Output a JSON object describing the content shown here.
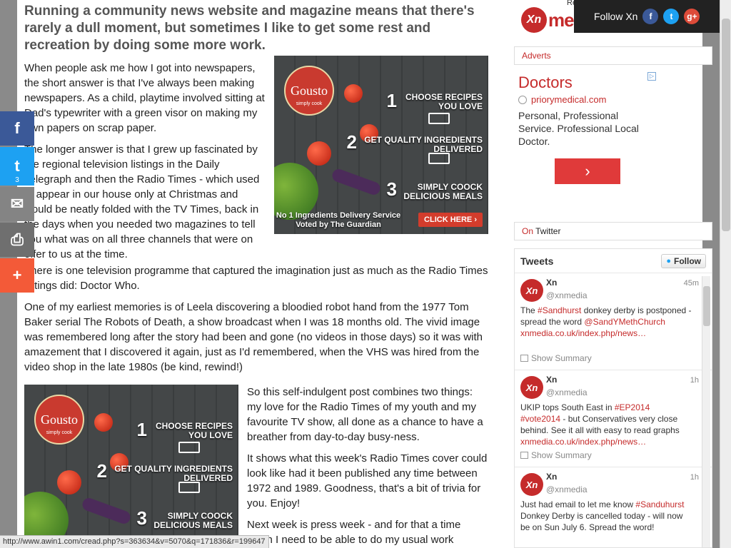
{
  "article": {
    "intro": "Running a community news website and magazine means that there's rarely a dull moment, but sometimes I like to get some rest and recreation by doing some more work.",
    "paragraphs": [
      "When people ask me how I got into newspapers, the short answer is that I've always been making newspapers. As a child, playtime involved sitting at Dad's typewriter with a green visor on making my own papers on scrap paper.",
      "The longer answer is that I grew up fascinated by the regional television listings in the Daily Telegraph and then the Radio Times - which used to appear in our house only at Christmas and would be neatly folded with the TV Times, back in the days when you needed two magazines to tell you what was on all three channels that were on offer to us at the time.",
      "There is one television programme that captured the imagination just as much as the Radio Times listings did: Doctor Who.",
      "One of my earliest memories is of Leela discovering a bloodied robot hand from the 1977 Tom Baker serial The Robots of Death, a show broadcast when I was 18 months old. The vivid image was remembered long after the story had been and gone (no videos in those days) so it was with amazement that I discovered it again, just as I'd remembered, when the VHS was hired from the video shop in the late 1980s (be kind, rewind!)",
      "So this self-indulgent post combines two things: my love for the Radio Times of my youth and my favourite TV show, all done as a chance to have a breather from day-to-day busy-ness.",
      "It shows what this week's Radio Times cover could look like had it been published any time between 1972 and 1989. Goodness, that's a bit of trivia for you. Enjoy!",
      "Next week is press week - and for that a time when I need to be able to do my usual work"
    ]
  },
  "ad": {
    "brand": "Gousto",
    "tagline": "simply cook",
    "step1_a": "CHOOSE RECIPES",
    "step1_b": "YOU LOVE",
    "step2_a": "GET QUALITY INGREDIENTS",
    "step2_b": "DELIVERED",
    "step3_a": "SIMPLY COOCK",
    "step3_b": "DELICIOUS MEALS",
    "n1": "1",
    "n2": "2",
    "n3": "3",
    "badge_a": "No 1 Ingredients Delivery Service",
    "badge_b": "Voted by The Guardian",
    "cta": "CLICK HERE ›"
  },
  "share": {
    "facebook": "f",
    "twitter": "t",
    "twitter_count": "3",
    "email": "✉",
    "print": "⎙",
    "more": "+"
  },
  "header": {
    "logo_xn": "Xn",
    "logo_media": "media",
    "reading": "Reading"
  },
  "followbar": {
    "label": "Follow Xn",
    "fb": "f",
    "tw": "t",
    "gp": "g+"
  },
  "sidebar": {
    "adverts_label": "Adverts",
    "google_ad": {
      "headline": "Doctors",
      "url": "priorymedical.com",
      "desc": "Personal, Professional Service. Professional Local Doctor.",
      "button": "›",
      "adchoices": "▷"
    },
    "twitter_head_on": "On",
    "twitter_head_label": "Twitter"
  },
  "tweets": {
    "title": "Tweets",
    "follow": "Follow",
    "items": [
      {
        "name": "Xn",
        "handle": "@xnmedia",
        "time": "45m",
        "pre": "The ",
        "tag1": "#Sandhurst",
        "mid": " donkey derby is postponed - spread the word ",
        "mention": "@SandYMethChurch",
        "link": "xnmedia.co.uk/index.php/news…",
        "summary": "Show Summary"
      },
      {
        "name": "Xn",
        "handle": "@xnmedia",
        "time": "1h",
        "pre": "UKIP tops South East in ",
        "tag1": "#EP2014",
        "tag2": "#vote2014",
        "mid": " - but Conservatives very close behind. See it all with easy to read graphs",
        "link": "xnmedia.co.uk/index.php/news…",
        "summary": "Show Summary"
      },
      {
        "name": "Xn",
        "handle": "@xnmedia",
        "time": "1h",
        "pre": "Just had email to let me know ",
        "tag1": "#Sanduhurst",
        "mid": " Donkey Derby is cancelled today - will now be on Sun July 6. Spread the word!"
      }
    ]
  },
  "status_url": "http://www.awin1.com/cread.php?s=363634&v=5070&q=171836&r=199647",
  "colors": {
    "brand_red": "#c52b2b",
    "facebook": "#3b5998",
    "twitter": "#1da1f2",
    "google": "#dd4b39"
  }
}
